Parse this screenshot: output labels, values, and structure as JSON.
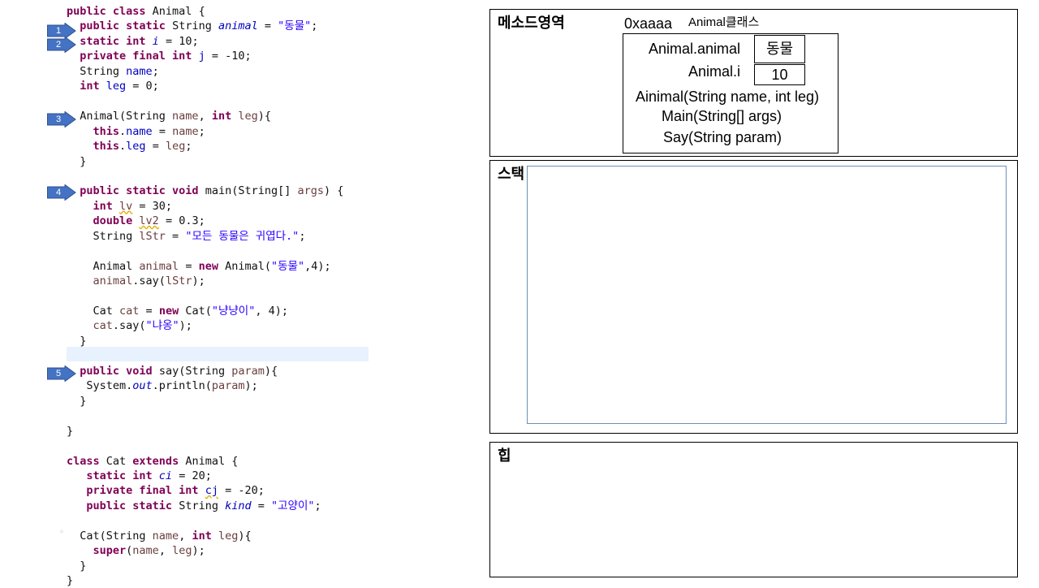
{
  "code": {
    "lines": [
      [
        {
          "t": "public class ",
          "c": "kw"
        },
        {
          "t": "Animal {",
          "c": ""
        }
      ],
      [
        {
          "t": "  "
        },
        {
          "t": "public static ",
          "c": "kw"
        },
        {
          "t": "String "
        },
        {
          "t": "animal",
          "c": "sfld"
        },
        {
          "t": " = "
        },
        {
          "t": "\"동물\"",
          "c": "str"
        },
        {
          "t": ";"
        }
      ],
      [
        {
          "t": "  "
        },
        {
          "t": "static int ",
          "c": "kw"
        },
        {
          "t": "i",
          "c": "sfld"
        },
        {
          "t": " = 10;"
        }
      ],
      [
        {
          "t": "  "
        },
        {
          "t": "private final int ",
          "c": "kw"
        },
        {
          "t": "j",
          "c": "fld"
        },
        {
          "t": " = -10;"
        }
      ],
      [
        {
          "t": "  String "
        },
        {
          "t": "name",
          "c": "fld"
        },
        {
          "t": ";"
        }
      ],
      [
        {
          "t": "  "
        },
        {
          "t": "int ",
          "c": "kw"
        },
        {
          "t": "leg",
          "c": "fld"
        },
        {
          "t": " = 0;"
        }
      ],
      [],
      [
        {
          "t": "  Animal(String "
        },
        {
          "t": "name",
          "c": "local"
        },
        {
          "t": ", "
        },
        {
          "t": "int ",
          "c": "kw"
        },
        {
          "t": "leg",
          "c": "local"
        },
        {
          "t": "){"
        }
      ],
      [
        {
          "t": "    "
        },
        {
          "t": "this",
          "c": "kw"
        },
        {
          "t": "."
        },
        {
          "t": "name",
          "c": "fld"
        },
        {
          "t": " = "
        },
        {
          "t": "name",
          "c": "local"
        },
        {
          "t": ";"
        }
      ],
      [
        {
          "t": "    "
        },
        {
          "t": "this",
          "c": "kw"
        },
        {
          "t": "."
        },
        {
          "t": "leg",
          "c": "fld"
        },
        {
          "t": " = "
        },
        {
          "t": "leg",
          "c": "local"
        },
        {
          "t": ";"
        }
      ],
      [
        {
          "t": "  }"
        }
      ],
      [],
      [
        {
          "t": "  "
        },
        {
          "t": "public static void ",
          "c": "kw"
        },
        {
          "t": "main(String[] "
        },
        {
          "t": "args",
          "c": "local"
        },
        {
          "t": ") {"
        }
      ],
      [
        {
          "t": "    "
        },
        {
          "t": "int ",
          "c": "kw"
        },
        {
          "t": "lv",
          "c": "local warn"
        },
        {
          "t": " = 30;"
        }
      ],
      [
        {
          "t": "    "
        },
        {
          "t": "double ",
          "c": "kw"
        },
        {
          "t": "lv2",
          "c": "local warn"
        },
        {
          "t": " = 0.3;"
        }
      ],
      [
        {
          "t": "    String "
        },
        {
          "t": "lStr",
          "c": "local"
        },
        {
          "t": " = "
        },
        {
          "t": "\"모든 동물은 귀엽다.\"",
          "c": "str"
        },
        {
          "t": ";"
        }
      ],
      [],
      [
        {
          "t": "    Animal "
        },
        {
          "t": "animal",
          "c": "local"
        },
        {
          "t": " = "
        },
        {
          "t": "new ",
          "c": "kw"
        },
        {
          "t": "Animal("
        },
        {
          "t": "\"동물\"",
          "c": "str"
        },
        {
          "t": ",4);"
        }
      ],
      [
        {
          "t": "    "
        },
        {
          "t": "animal",
          "c": "local"
        },
        {
          "t": ".say("
        },
        {
          "t": "lStr",
          "c": "local"
        },
        {
          "t": ");"
        }
      ],
      [],
      [
        {
          "t": "    Cat "
        },
        {
          "t": "cat",
          "c": "local"
        },
        {
          "t": " = "
        },
        {
          "t": "new ",
          "c": "kw"
        },
        {
          "t": "Cat("
        },
        {
          "t": "\"냥냥이\"",
          "c": "str"
        },
        {
          "t": ", 4);"
        }
      ],
      [
        {
          "t": "    "
        },
        {
          "t": "cat",
          "c": "local"
        },
        {
          "t": ".say("
        },
        {
          "t": "\"냐옹\"",
          "c": "str"
        },
        {
          "t": ");"
        }
      ],
      [
        {
          "t": "  }"
        }
      ],
      [],
      [
        {
          "t": "  "
        },
        {
          "t": "public void ",
          "c": "kw"
        },
        {
          "t": "say(String "
        },
        {
          "t": "param",
          "c": "local"
        },
        {
          "t": "){"
        }
      ],
      [
        {
          "t": "   System."
        },
        {
          "t": "out",
          "c": "sfld"
        },
        {
          "t": ".println("
        },
        {
          "t": "param",
          "c": "local"
        },
        {
          "t": ");"
        }
      ],
      [
        {
          "t": "  }"
        }
      ],
      [],
      [
        {
          "t": "}"
        }
      ],
      [],
      [
        {
          "t": "class ",
          "c": "kw"
        },
        {
          "t": "Cat "
        },
        {
          "t": "extends ",
          "c": "kw"
        },
        {
          "t": "Animal {"
        }
      ],
      [
        {
          "t": "   "
        },
        {
          "t": "static int ",
          "c": "kw"
        },
        {
          "t": "ci",
          "c": "sfld"
        },
        {
          "t": " = 20;"
        }
      ],
      [
        {
          "t": "   "
        },
        {
          "t": "private final int ",
          "c": "kw"
        },
        {
          "t": "cj",
          "c": "fld warn"
        },
        {
          "t": " = -20;"
        }
      ],
      [
        {
          "t": "   "
        },
        {
          "t": "public static ",
          "c": "kw"
        },
        {
          "t": "String "
        },
        {
          "t": "kind",
          "c": "sfld"
        },
        {
          "t": " = "
        },
        {
          "t": "\"고양이\"",
          "c": "str"
        },
        {
          "t": ";"
        }
      ],
      [],
      [
        {
          "t": "  Cat(String "
        },
        {
          "t": "name",
          "c": "local"
        },
        {
          "t": ", "
        },
        {
          "t": "int ",
          "c": "kw"
        },
        {
          "t": "leg",
          "c": "local"
        },
        {
          "t": "){"
        }
      ],
      [
        {
          "t": "    "
        },
        {
          "t": "super",
          "c": "kw"
        },
        {
          "t": "("
        },
        {
          "t": "name",
          "c": "local"
        },
        {
          "t": ", "
        },
        {
          "t": "leg",
          "c": "local"
        },
        {
          "t": ");"
        }
      ],
      [
        {
          "t": "  }"
        }
      ],
      [
        {
          "t": "}"
        }
      ]
    ],
    "markers": [
      "1",
      "2",
      "3",
      "4",
      "5"
    ]
  },
  "memory": {
    "method_area": {
      "label": "메소드영역",
      "address": "0xaaaa",
      "class_label": "Animal클래스",
      "field1_name": "Animal.animal",
      "field1_value": "동물",
      "field2_name": "Animal.i",
      "field2_value": "10",
      "method1": "Ainimal(String name, int leg)",
      "method2": "Main(String[] args)",
      "method3": "Say(String param)"
    },
    "stack": {
      "label": "스택"
    },
    "heap": {
      "label": "힙"
    }
  },
  "colors": {
    "marker_fill": "#4472c4",
    "marker_stroke": "#2f528f",
    "keyword": "#7f0055",
    "string": "#2a00ff",
    "field": "#0000c0",
    "stack_inner_border": "#6c8fb5"
  }
}
